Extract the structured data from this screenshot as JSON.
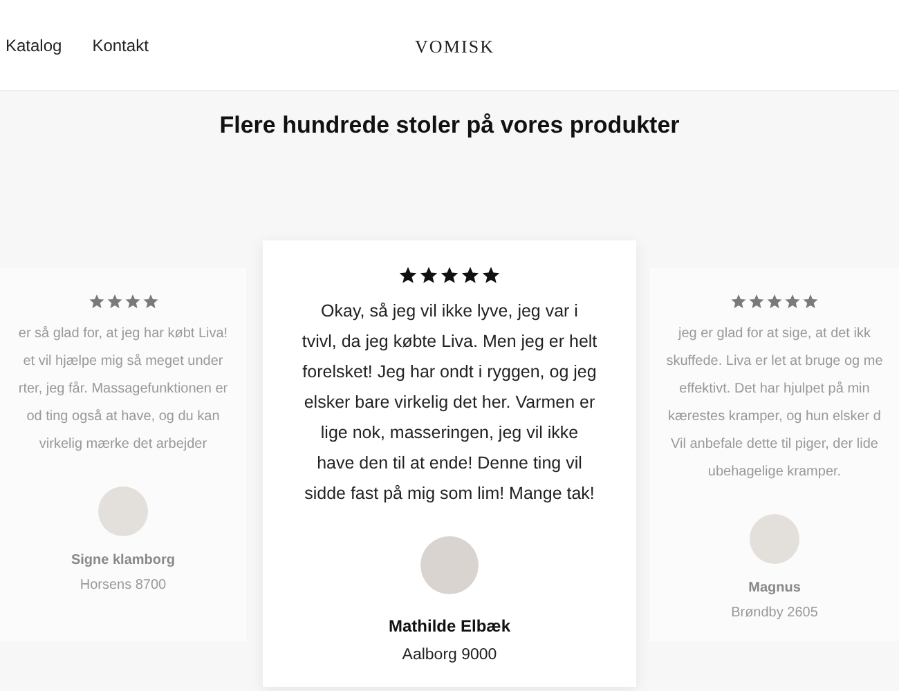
{
  "nav": {
    "links": [
      "Katalog",
      "Kontakt"
    ],
    "logo": "VOMISK"
  },
  "heading": "Flere hundrede stoler på vores produkter",
  "reviews": [
    {
      "selected": false,
      "stars": 4,
      "text_lines": [
        "er så glad for, at jeg har købt Liva!",
        "et vil hjælpe mig så meget under",
        "rter, jeg får. Massagefunktionen er",
        "od ting også at have, og du kan",
        "virkelig mærke det arbejder"
      ],
      "name": "Signe klamborg",
      "location": "Horsens 8700"
    },
    {
      "selected": true,
      "stars": 5,
      "text_lines": [
        "Okay, så jeg vil ikke lyve, jeg var i",
        "tvivl, da jeg købte Liva. Men jeg er helt",
        "forelsket! Jeg har ondt i ryggen, og jeg",
        "elsker bare virkelig det her. Varmen er",
        "lige nok, masseringen, jeg vil ikke",
        "have den til at ende! Denne ting vil",
        "sidde fast på mig som lim! Mange tak!"
      ],
      "name": "Mathilde Elbæk",
      "location": "Aalborg 9000"
    },
    {
      "selected": false,
      "stars": 5,
      "text_lines": [
        "jeg er glad for at sige, at det ikk",
        "skuffede. Liva er let at bruge og me",
        "effektivt. Det har hjulpet på min",
        "kærestes kramper, og hun elsker d",
        "Vil anbefale dette til piger, der lide",
        "ubehagelige kramper."
      ],
      "name": "Magnus",
      "location": "Brøndby 2605"
    }
  ]
}
